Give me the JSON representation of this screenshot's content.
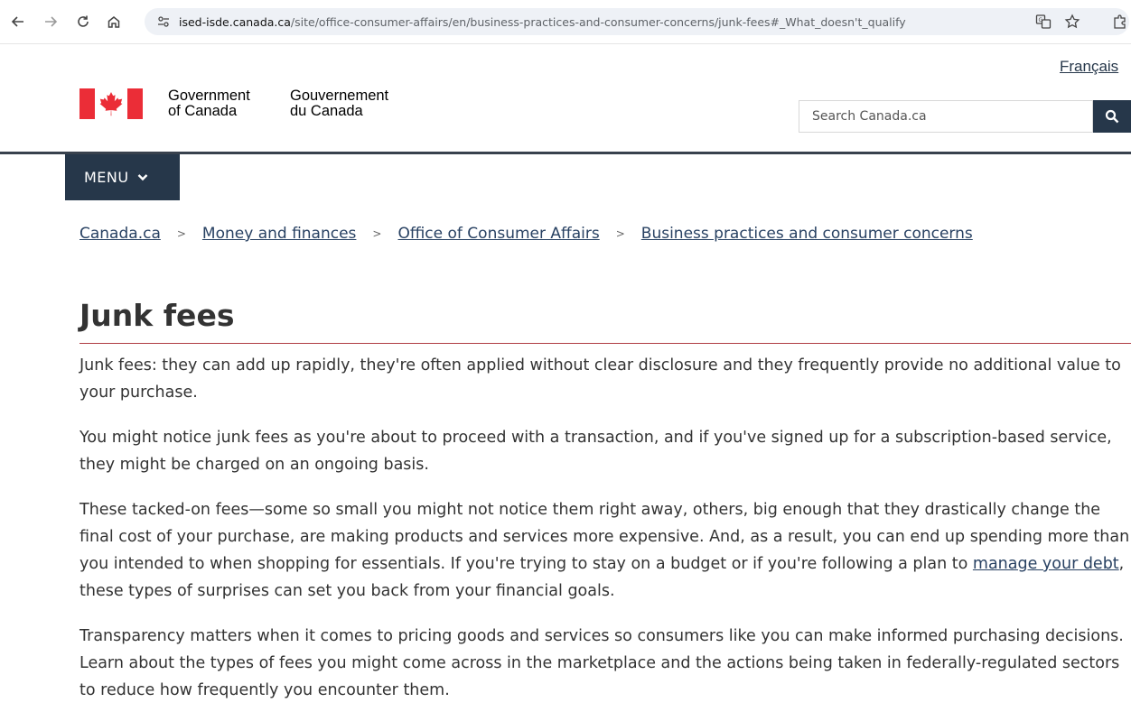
{
  "browser": {
    "back_icon": "back-arrow-icon",
    "forward_icon": "forward-arrow-icon",
    "reload_icon": "reload-icon",
    "home_icon": "home-icon",
    "url_host": "ised-isde.canada.ca",
    "url_path": "/site/office-consumer-affairs/en/business-practices-and-consumer-concerns/junk-fees#_What_doesn't_qualify"
  },
  "header": {
    "language_link": "Français",
    "gov_en_line1": "Government",
    "gov_en_line2": "of Canada",
    "gov_fr_line1": "Gouvernement",
    "gov_fr_line2": "du Canada",
    "search_placeholder": "Search Canada.ca",
    "menu_label": "MENU",
    "flag_color": "#eb2d37",
    "brand_dark": "#26374a"
  },
  "breadcrumb": [
    "Canada.ca",
    "Money and finances",
    "Office of Consumer Affairs",
    "Business practices and consumer concerns"
  ],
  "main": {
    "title": "Junk fees",
    "p1": "Junk fees: they can add up rapidly, they're often applied without clear disclosure and they frequently provide no additional value to your purchase.",
    "p2": "You might notice junk fees as you're about to proceed with a transaction, and if you've signed up for a subscription-based service, they might be charged on an ongoing basis.",
    "p3_before": "These tacked-on fees—some so small you might not notice them right away, others, big enough that they drastically change the final cost of your purchase, are making products and services more expensive. And, as a result, you can end up spending more than you intended to when shopping for essentials. If you're trying to stay on a budget or if you're following a plan to ",
    "p3_link": "manage your debt",
    "p3_after": ", these types of surprises can set you back from your financial goals.",
    "p4": "Transparency matters when it comes to pricing goods and services so consumers like you can make informed purchasing decisions. Learn about the types of fees you might come across in the marketplace and the actions being taken in federally-regulated sectors to reduce how frequently you encounter them."
  }
}
